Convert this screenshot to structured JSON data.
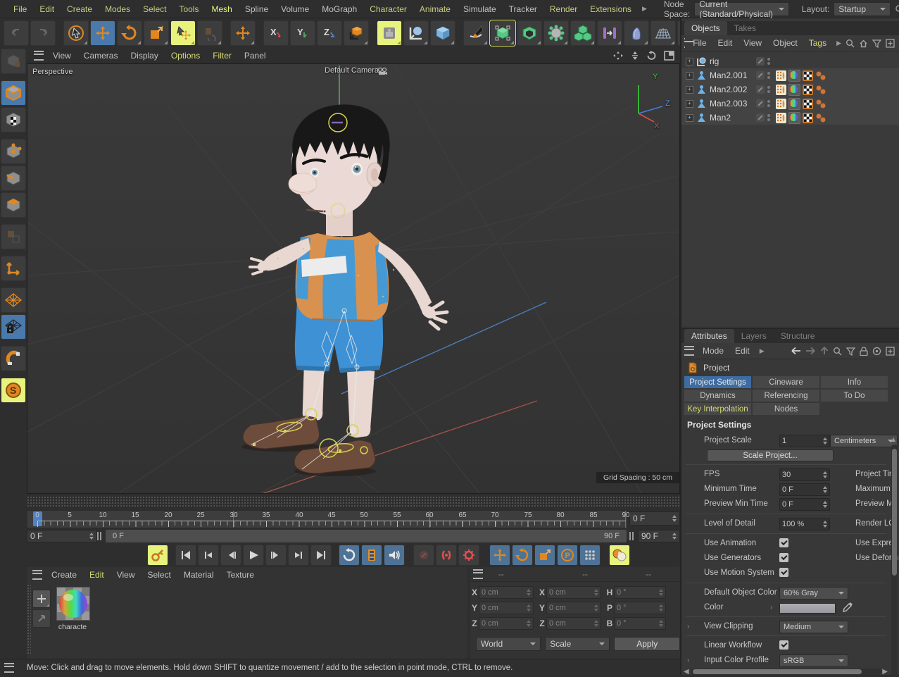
{
  "menubar": {
    "items": [
      {
        "label": "File"
      },
      {
        "label": "Edit"
      },
      {
        "label": "Create"
      },
      {
        "label": "Modes"
      },
      {
        "label": "Select"
      },
      {
        "label": "Tools"
      },
      {
        "label": "Mesh"
      },
      {
        "label": "Spline"
      },
      {
        "label": "Volume"
      },
      {
        "label": "MoGraph"
      },
      {
        "label": "Character"
      },
      {
        "label": "Animate"
      },
      {
        "label": "Simulate"
      },
      {
        "label": "Tracker"
      },
      {
        "label": "Render"
      },
      {
        "label": "Extensions"
      }
    ],
    "node_space_label": "Node Space:",
    "node_space_value": "Current (Standard/Physical)",
    "layout_label": "Layout:",
    "layout_value": "Startup"
  },
  "viewport": {
    "menu": [
      {
        "label": "View"
      },
      {
        "label": "Cameras"
      },
      {
        "label": "Display"
      },
      {
        "label": "Options"
      },
      {
        "label": "Filter"
      },
      {
        "label": "Panel"
      }
    ],
    "view_label": "Perspective",
    "camera_label": "Default Camera",
    "grid_spacing": "Grid Spacing : 50 cm",
    "axis_x": "X",
    "axis_y": "Y",
    "axis_z": "Z"
  },
  "objects_panel": {
    "tabs": [
      {
        "label": "Objects"
      },
      {
        "label": "Takes"
      }
    ],
    "menu": [
      {
        "label": "File"
      },
      {
        "label": "Edit"
      },
      {
        "label": "View"
      },
      {
        "label": "Object"
      },
      {
        "label": "Tags"
      }
    ],
    "rows": [
      {
        "name": "rig"
      },
      {
        "name": "Man2.001"
      },
      {
        "name": "Man2.002"
      },
      {
        "name": "Man2.003"
      },
      {
        "name": "Man2"
      }
    ]
  },
  "attributes_panel": {
    "tabs": [
      {
        "label": "Attributes"
      },
      {
        "label": "Layers"
      },
      {
        "label": "Structure"
      }
    ],
    "menu": [
      {
        "label": "Mode"
      },
      {
        "label": "Edit"
      }
    ],
    "object_label": "Project",
    "section_tabs": [
      {
        "label": "Project Settings"
      },
      {
        "label": "Cineware"
      },
      {
        "label": "Info"
      },
      {
        "label": "Dynamics"
      },
      {
        "label": "Referencing"
      },
      {
        "label": "To Do"
      },
      {
        "label": "Key Interpolation"
      },
      {
        "label": "Nodes"
      }
    ],
    "heading": "Project Settings",
    "project_scale_label": "Project Scale",
    "project_scale_value": "1",
    "project_scale_unit": "Centimeters",
    "scale_project_button": "Scale Project...",
    "fps_label": "FPS",
    "fps_value": "30",
    "min_time_label": "Minimum Time",
    "min_time_value": "0 F",
    "preview_min_label": "Preview Min Time",
    "preview_min_value": "0 F",
    "lod_label": "Level of Detail",
    "lod_value": "100 %",
    "use_animation_label": "Use Animation",
    "use_generators_label": "Use Generators",
    "use_motion_label": "Use Motion System",
    "right_label_project_time": "Project Tim",
    "right_label_maximum": "Maximum T",
    "right_label_preview_max": "Preview Ma",
    "right_label_render_lod": "Render LOI",
    "right_label_use_expressions": "Use Expres",
    "right_label_use_deformers": "Use Deform",
    "default_color_label": "Default Object Color",
    "default_color_value": "60% Gray",
    "color_label": "Color",
    "view_clipping_label": "View Clipping",
    "view_clipping_value": "Medium",
    "linear_workflow_label": "Linear Workflow",
    "input_profile_label": "Input Color Profile",
    "input_profile_value": "sRGB"
  },
  "timeline": {
    "ticks": [
      "0",
      "5",
      "10",
      "15",
      "20",
      "25",
      "30",
      "35",
      "40",
      "45",
      "50",
      "55",
      "60",
      "65",
      "70",
      "75",
      "80",
      "85",
      "90"
    ],
    "current_frame": "0 F",
    "range_start": "0 F",
    "range_end": "90 F",
    "end_frame": "90 F"
  },
  "materials": {
    "menu": [
      {
        "label": "Create"
      },
      {
        "label": "Edit"
      },
      {
        "label": "View"
      },
      {
        "label": "Select"
      },
      {
        "label": "Material"
      },
      {
        "label": "Texture"
      }
    ],
    "items": [
      {
        "name": "characte"
      }
    ]
  },
  "coordinates": {
    "headers": [
      "--",
      "--",
      "--"
    ],
    "pos_x_label": "X",
    "pos_x": "0 cm",
    "pos_y_label": "Y",
    "pos_y": "0 cm",
    "pos_z_label": "Z",
    "pos_z": "0 cm",
    "scale_x_label": "X",
    "scale_x": "0 cm",
    "scale_y_label": "Y",
    "scale_y": "0 cm",
    "scale_z_label": "Z",
    "scale_z": "0 cm",
    "rot_h_label": "H",
    "rot_h": "0 °",
    "rot_p_label": "P",
    "rot_p": "0 °",
    "rot_b_label": "B",
    "rot_b": "0 °",
    "space_value": "World",
    "mode_value": "Scale",
    "apply_button": "Apply"
  },
  "statusbar": {
    "text": "Move: Click and drag to move elements. Hold down SHIFT to quantize movement / add to the selection in point mode, CTRL to remove."
  },
  "colors": {
    "accent_blue": "#3d6ca3",
    "highlight_yellow": "#e7f37c",
    "icon_orange": "#e0871f",
    "menu_yellow": "#c9cd82",
    "viewport_bg": "#363636"
  }
}
